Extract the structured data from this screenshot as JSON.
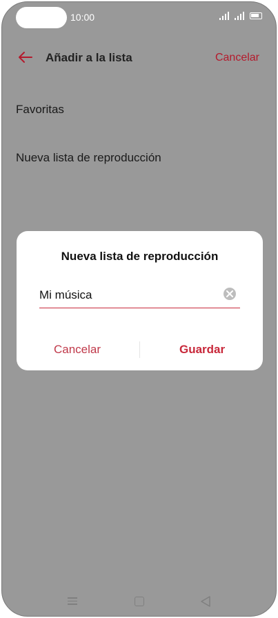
{
  "status_bar": {
    "time": "10:00"
  },
  "header": {
    "title": "Añadir a la lista",
    "cancel_label": "Cancelar"
  },
  "list": {
    "items": [
      {
        "label": "Favoritas"
      },
      {
        "label": "Nueva lista de reproducción"
      }
    ]
  },
  "dialog": {
    "title": "Nueva lista de reproducción",
    "input_value": "Mi música",
    "cancel_label": "Cancelar",
    "save_label": "Guardar"
  },
  "colors": {
    "accent": "#c8283a",
    "overlay": "#999999"
  },
  "icons": {
    "back": "arrow-left-icon",
    "clear": "clear-circle-icon",
    "nav_menu": "menu-lines-icon",
    "nav_home": "square-home-icon",
    "nav_back": "triangle-back-icon"
  }
}
